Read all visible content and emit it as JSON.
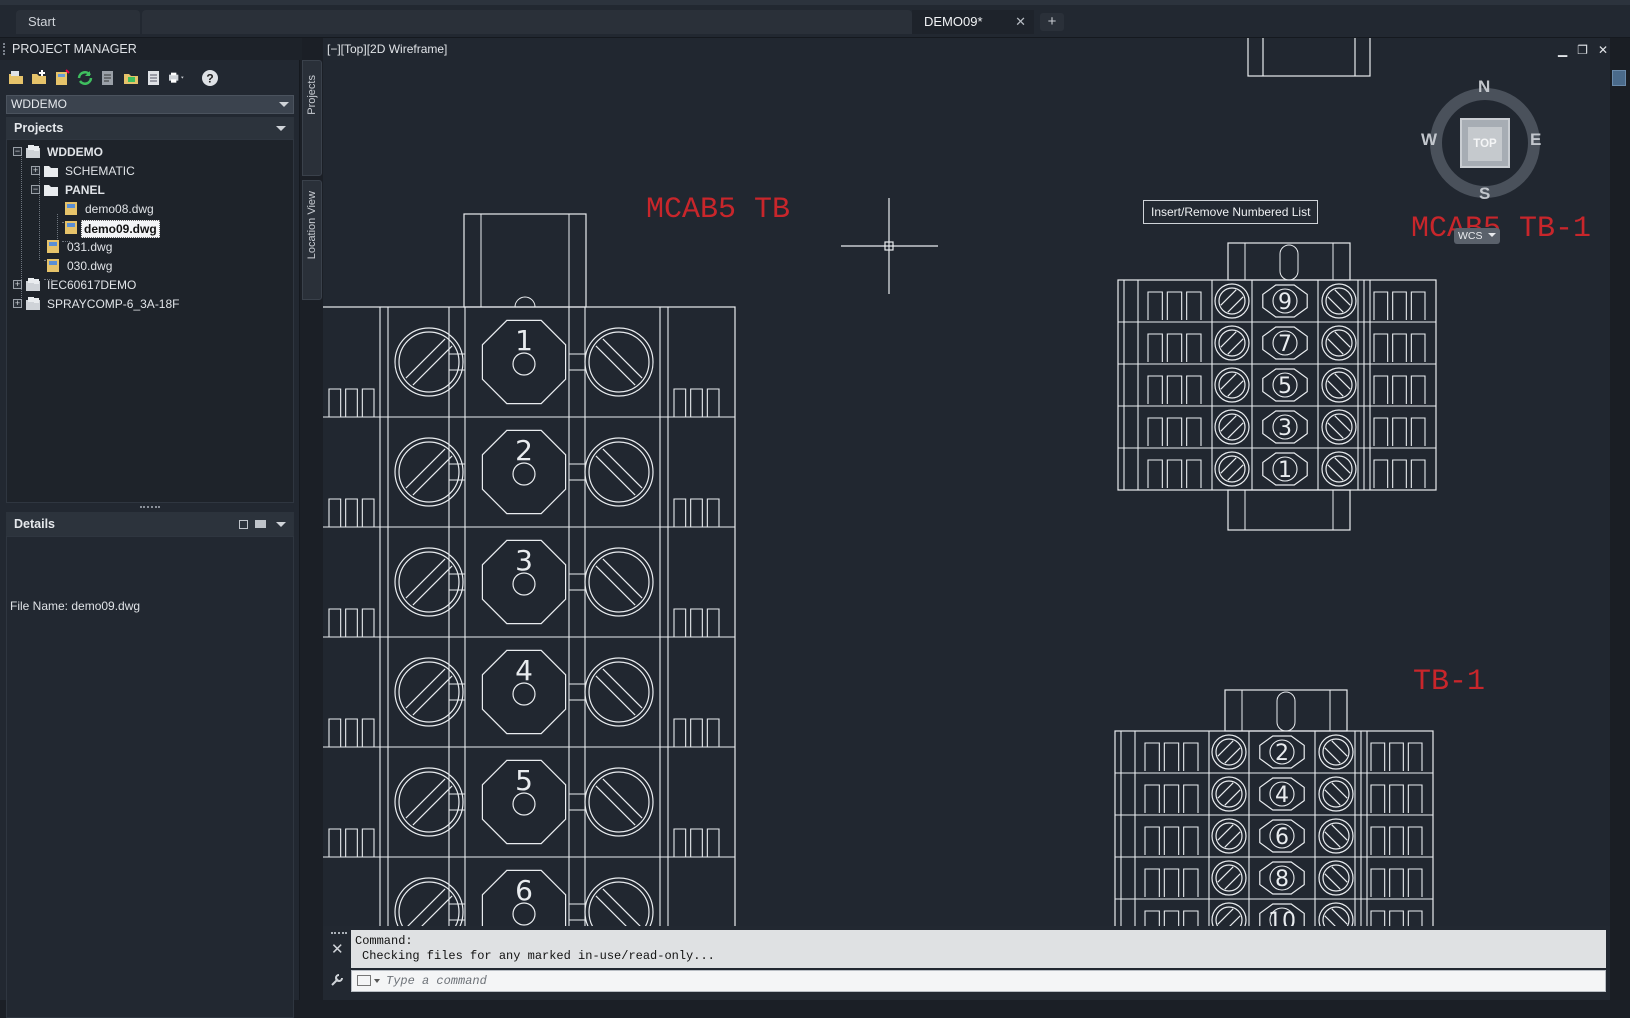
{
  "tabs": {
    "start": "Start",
    "active_file": "DEMO09*",
    "close_glyph": "✕",
    "new_tab_glyph": "+"
  },
  "project_manager": {
    "title": "PROJECT MANAGER",
    "selected_project": "WDDEMO",
    "projects_header": "Projects",
    "tree": {
      "root": "WDDEMO",
      "schematic": "SCHEMATIC",
      "panel": "PANEL",
      "demo08": "demo08.dwg",
      "demo09": "demo09.dwg",
      "f031": "031.dwg",
      "f030": "030.dwg",
      "iec": "IEC60617DEMO",
      "spray": "SPRAYCOMP-6_3A-18F"
    },
    "details_header": "Details",
    "details_file": "File Name: demo09.dwg",
    "side_tabs": {
      "projects": "Projects",
      "location": "Location View"
    },
    "toolbar_icons": [
      "open-project-icon",
      "new-project-icon",
      "new-drawing-icon",
      "refresh-icon",
      "project-properties-icon",
      "drawing-properties-icon",
      "project-task-list-icon",
      "publish-icon",
      "help-icon"
    ]
  },
  "viewport": {
    "label": "[−][Top][2D Wireframe]",
    "minimize": "▁",
    "restore": "❐",
    "close": "✕"
  },
  "drawing": {
    "label_mcab5_tb": "MCAB5 TB",
    "label_mcab5_tb1": "MCAB5 TB-1",
    "label_tb1": "TB-1",
    "left_terminals": [
      "1",
      "2",
      "3",
      "4",
      "5",
      "6"
    ],
    "right_top_terminals": [
      "9",
      "7",
      "5",
      "3",
      "1"
    ],
    "right_bottom_terminals": [
      "2",
      "4",
      "6",
      "8",
      "10"
    ],
    "text_color": "#c8262b",
    "line_color": "#e9ecef"
  },
  "tooltip": "Insert/Remove Numbered List",
  "viewcube": {
    "face": "TOP",
    "n": "N",
    "s": "S",
    "e": "E",
    "w": "W",
    "ucs": "WCS"
  },
  "command_line": {
    "history": [
      "Command:",
      "Checking files for any marked in-use/read-only..."
    ],
    "placeholder": "Type a command",
    "close_glyph": "✕"
  }
}
